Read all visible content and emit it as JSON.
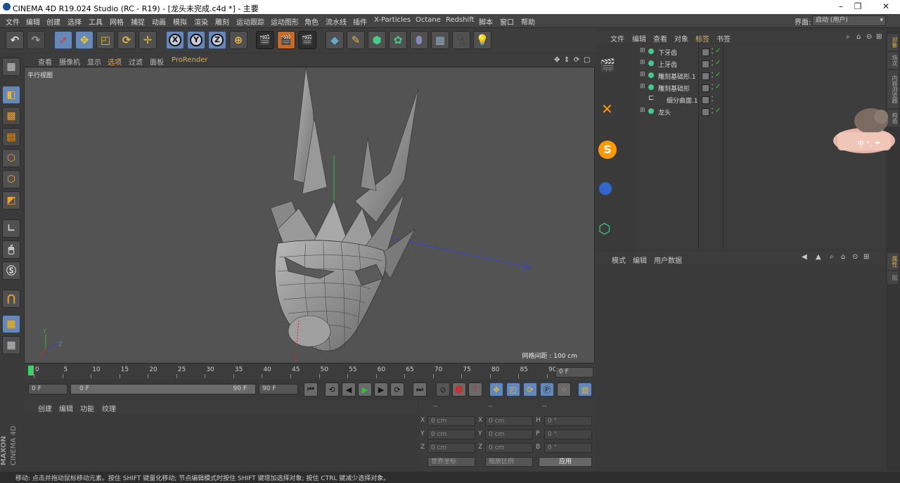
{
  "window": {
    "title": "CINEMA 4D R19.024 Studio (RC - R19) - [龙头未完成.c4d *] - 主要"
  },
  "menubar": {
    "items": [
      "文件",
      "编辑",
      "创建",
      "选择",
      "工具",
      "网格",
      "捕捉",
      "动画",
      "模拟",
      "渲染",
      "雕刻",
      "运动跟踪",
      "运动图形",
      "角色",
      "流水线",
      "插件",
      "X-Particles",
      "Octane",
      "Redshift",
      "脚本",
      "窗口",
      "帮助"
    ],
    "layout_label": "界面:",
    "layout_value": "启动 (用户)"
  },
  "viewport": {
    "menu": [
      "查看",
      "摄像机",
      "显示",
      "选项",
      "过滤",
      "面板",
      "ProRender"
    ],
    "view_name": "平行视图",
    "grid_info": "网格间距 : 100 cm"
  },
  "timeline": {
    "ticks": [
      "0",
      "5",
      "10",
      "15",
      "20",
      "25",
      "30",
      "35",
      "40",
      "45",
      "50",
      "55",
      "60",
      "65",
      "70",
      "75",
      "80",
      "85",
      "90"
    ],
    "current_frame": "0 F",
    "start": "0 F",
    "range_start": "0 F",
    "range_end": "90 F",
    "end": "90 F"
  },
  "material": {
    "menu": [
      "创建",
      "编辑",
      "功能",
      "纹理"
    ]
  },
  "coords": {
    "headers": [
      "--",
      "--",
      "--"
    ],
    "rows": [
      {
        "a": "X",
        "av": "0 cm",
        "b": "X",
        "bv": "0 cm",
        "c": "H",
        "cv": "0 °"
      },
      {
        "a": "Y",
        "av": "0 cm",
        "b": "Y",
        "bv": "0 cm",
        "c": "P",
        "cv": "0 °"
      },
      {
        "a": "Z",
        "av": "0 cm",
        "b": "Z",
        "bv": "0 cm",
        "c": "B",
        "cv": "0 °"
      }
    ],
    "world": "世界坐标",
    "scale": "缩放比例",
    "apply": "应用"
  },
  "object_manager": {
    "menu": [
      "文件",
      "编辑",
      "查看",
      "对象",
      "标签",
      "书签"
    ],
    "objects": [
      {
        "name": "下牙齿",
        "indent": 0
      },
      {
        "name": "上牙齿",
        "indent": 0
      },
      {
        "name": "雕刻基础形.1",
        "indent": 0
      },
      {
        "name": "雕刻基础形",
        "indent": 0
      },
      {
        "name": "细分曲面.1",
        "indent": 1
      },
      {
        "name": "龙头",
        "indent": 0
      }
    ]
  },
  "attributes": {
    "menu": [
      "模式",
      "编辑",
      "用户数据"
    ]
  },
  "side_tabs": [
    "对象",
    "场次",
    "内容浏览器",
    "构造",
    "属性",
    "层"
  ],
  "widget": {
    "label": "中 °, ☂"
  },
  "brand": {
    "maxon": "MAXON",
    "product": "CINEMA 4D"
  },
  "status": {
    "text": "移动: 点击并拖动鼠标移动元素。按住 SHIFT 键量化移动; 节点编辑模式时按住 SHIFT 键增加选择对象; 按住 CTRL 键减少选择对象。"
  }
}
